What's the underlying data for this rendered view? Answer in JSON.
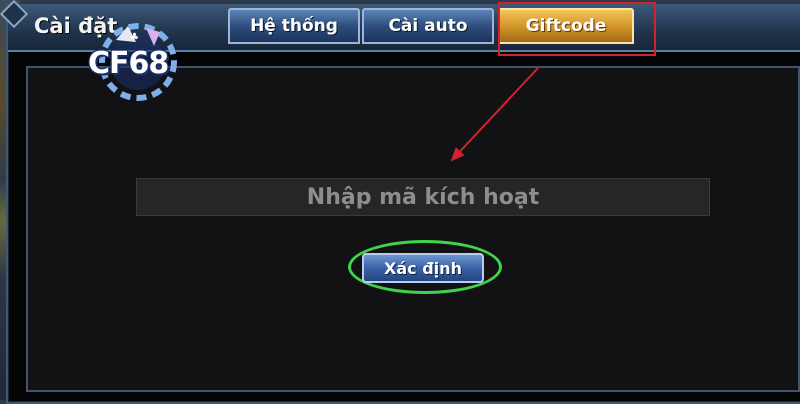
{
  "window": {
    "title": "Cài đặt"
  },
  "tabs": [
    {
      "label": "Hệ thống",
      "active": false
    },
    {
      "label": "Cài auto",
      "active": false
    },
    {
      "label": "Giftcode",
      "active": true
    }
  ],
  "giftcode": {
    "input_placeholder": "Nhập mã kích hoạt",
    "input_value": "",
    "confirm_label": "Xác định"
  },
  "logo": {
    "text": "CF68"
  },
  "colors": {
    "annotation_red": "#d1232d",
    "annotation_green": "#3fd44a",
    "tab_active": "#d49629",
    "tab_normal": "#2f4e7e"
  }
}
